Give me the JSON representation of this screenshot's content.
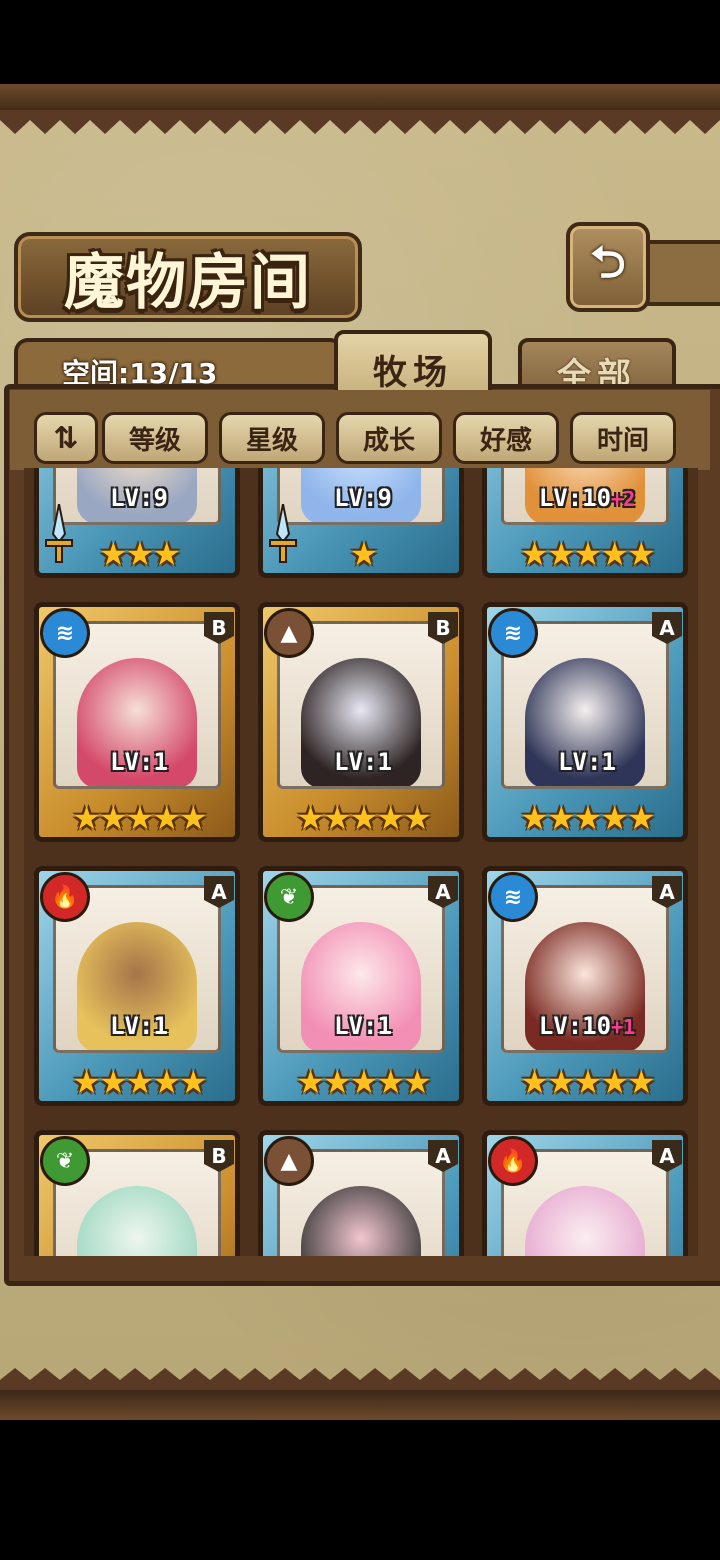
{
  "title": "魔物房间",
  "back_label": "⮌",
  "space": "空间:13/13",
  "tabs": [
    {
      "label": "牧场",
      "active": true
    },
    {
      "label": "全部",
      "active": false
    }
  ],
  "sort_toggle_label": "⇅",
  "filters": [
    "等级",
    "星级",
    "成长",
    "好感",
    "时间"
  ],
  "cards_row0": [
    {
      "level": "LV:9",
      "plus": "",
      "stars": "★★★",
      "has_sword": true
    },
    {
      "level": "LV:9",
      "plus": "",
      "stars": "★",
      "has_sword": true
    },
    {
      "level": "LV:10",
      "plus": "+2",
      "stars": "★★★★★",
      "has_sword": false
    }
  ],
  "cards_row1": [
    {
      "element": "water",
      "rank": "B",
      "level": "LV:1",
      "plus": "",
      "stars": "★★★★★",
      "frame": "gold"
    },
    {
      "element": "earth",
      "rank": "B",
      "level": "LV:1",
      "plus": "",
      "stars": "★★★★★",
      "frame": "gold"
    },
    {
      "element": "water",
      "rank": "A",
      "level": "LV:1",
      "plus": "",
      "stars": "★★★★★",
      "frame": "blue"
    }
  ],
  "cards_row2": [
    {
      "element": "fire",
      "rank": "A",
      "level": "LV:1",
      "plus": "",
      "stars": "★★★★★",
      "frame": "blue"
    },
    {
      "element": "grass",
      "rank": "A",
      "level": "LV:1",
      "plus": "",
      "stars": "★★★★★",
      "frame": "blue"
    },
    {
      "element": "water",
      "rank": "A",
      "level": "LV:10",
      "plus": "+1",
      "stars": "★★★★★",
      "frame": "blue"
    }
  ],
  "cards_row3": [
    {
      "element": "grass",
      "rank": "B",
      "frame": "gold"
    },
    {
      "element": "earth",
      "rank": "A",
      "frame": "blue"
    },
    {
      "element": "fire",
      "rank": "A",
      "frame": "blue"
    }
  ],
  "element_icons": {
    "water": "≋",
    "earth": "▲",
    "fire": "🔥",
    "grass": "❦"
  },
  "colors": {
    "star": "#ffc21c",
    "plus": "#ff3b8a",
    "wood": "#5c3c22"
  }
}
